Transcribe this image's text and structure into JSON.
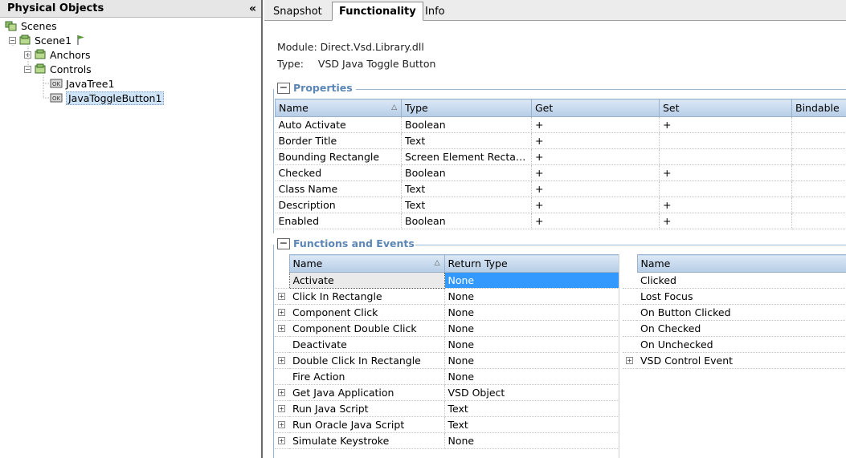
{
  "left_panel": {
    "title": "Physical Objects",
    "collapse": "«",
    "tree": [
      {
        "label": "Scenes",
        "icon": "scenes-icon"
      },
      {
        "label": "Scene1",
        "icon": "scene-icon",
        "flag": "flag-icon",
        "expander": "−"
      },
      {
        "label": "Anchors",
        "icon": "folder-objects-icon",
        "expander": "+"
      },
      {
        "label": "Controls",
        "icon": "folder-objects-icon",
        "expander": "−"
      },
      {
        "label": "JavaTree1",
        "icon": "ok-control-icon"
      },
      {
        "label": "JavaToggleButton1",
        "icon": "ok-control-icon",
        "selected": true
      }
    ]
  },
  "tabs": [
    {
      "label": "Snapshot",
      "active": false
    },
    {
      "label": "Functionality",
      "active": true
    },
    {
      "label": "Info",
      "active": false
    }
  ],
  "info": {
    "module_label": "Module:",
    "module_value": "Direct.Vsd.Library.dll",
    "type_label": "Type:",
    "type_value": "VSD Java Toggle Button"
  },
  "properties": {
    "toggle": "−",
    "title": "Properties",
    "columns": [
      "Name",
      "Type",
      "Get",
      "Set",
      "Bindable"
    ],
    "rows": [
      [
        "Auto Activate",
        "Boolean",
        "+",
        "+",
        ""
      ],
      [
        "Border Title",
        "Text",
        "+",
        "",
        ""
      ],
      [
        "Bounding Rectangle",
        "Screen Element Rectan...",
        "+",
        "",
        ""
      ],
      [
        "Checked",
        "Boolean",
        "+",
        "+",
        ""
      ],
      [
        "Class Name",
        "Text",
        "+",
        "",
        ""
      ],
      [
        "Description",
        "Text",
        "+",
        "+",
        ""
      ],
      [
        "Enabled",
        "Boolean",
        "+",
        "+",
        ""
      ]
    ]
  },
  "functions": {
    "toggle": "−",
    "title": "Functions and Events",
    "columns": [
      "Name",
      "Return Type"
    ],
    "rows": [
      {
        "name": "Activate",
        "ret": "None",
        "exp": false,
        "selected": true
      },
      {
        "name": "Click In Rectangle",
        "ret": "None",
        "exp": true
      },
      {
        "name": "Component Click",
        "ret": "None",
        "exp": true
      },
      {
        "name": "Component Double Click",
        "ret": "None",
        "exp": true
      },
      {
        "name": "Deactivate",
        "ret": "None",
        "exp": false
      },
      {
        "name": "Double Click In Rectangle",
        "ret": "None",
        "exp": true
      },
      {
        "name": "Fire Action",
        "ret": "None",
        "exp": false
      },
      {
        "name": "Get Java Application",
        "ret": "VSD Object",
        "exp": true
      },
      {
        "name": "Run Java Script",
        "ret": "Text",
        "exp": true
      },
      {
        "name": "Run Oracle Java Script",
        "ret": "Text",
        "exp": true
      },
      {
        "name": "Simulate Keystroke",
        "ret": "None",
        "exp": true
      }
    ]
  },
  "events": {
    "columns": [
      "Name"
    ],
    "rows": [
      {
        "name": "Clicked",
        "exp": false
      },
      {
        "name": "Lost Focus",
        "exp": false
      },
      {
        "name": "On Button Clicked",
        "exp": false
      },
      {
        "name": "On Checked",
        "exp": false
      },
      {
        "name": "On Unchecked",
        "exp": false
      },
      {
        "name": "VSD Control Event",
        "exp": true
      }
    ]
  },
  "colors": {
    "accent": "#5b86b5",
    "selection": "#3399ff",
    "header_gradient_top": "#dbe8f6",
    "header_gradient_bottom": "#b6cde6"
  }
}
